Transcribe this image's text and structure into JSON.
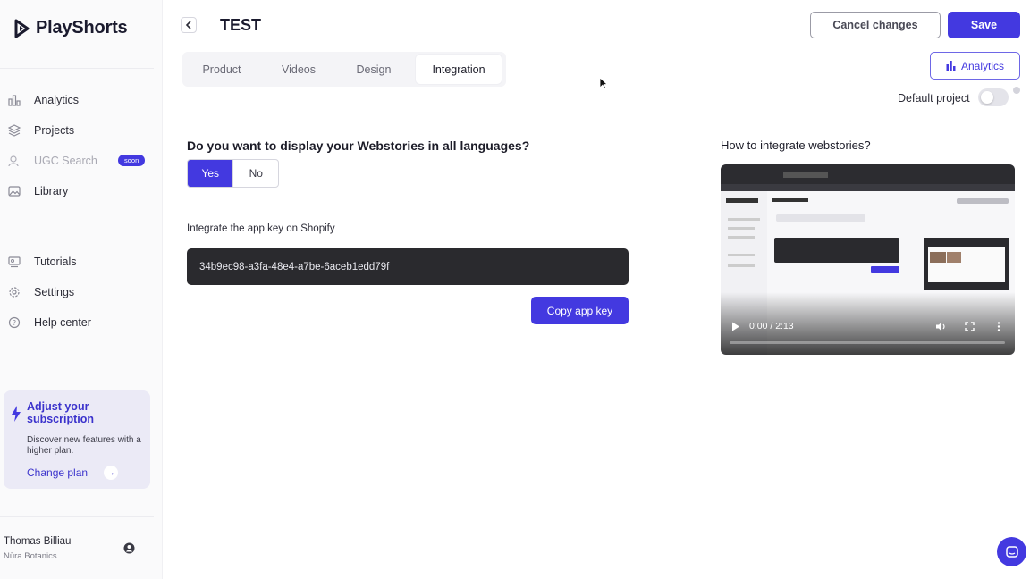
{
  "app": {
    "brand": "PlayShorts"
  },
  "sidebar": {
    "items": [
      {
        "label": "Analytics",
        "icon": "bar-chart-icon"
      },
      {
        "label": "Projects",
        "icon": "layers-icon"
      },
      {
        "label": "UGC Search",
        "icon": "users-search-icon",
        "badge": "soon",
        "disabled": true
      },
      {
        "label": "Library",
        "icon": "image-icon"
      },
      {
        "label": "Tutorials",
        "icon": "video-tutorial-icon"
      },
      {
        "label": "Settings",
        "icon": "gear-icon"
      },
      {
        "label": "Help center",
        "icon": "help-circle-icon"
      }
    ],
    "subscription": {
      "title": "Adjust your subscription",
      "description": "Discover new features with a higher plan.",
      "link": "Change plan"
    },
    "user": {
      "name": "Thomas Billiau",
      "org": "Nūra Botanics"
    }
  },
  "header": {
    "title": "TEST",
    "cancel_label": "Cancel changes",
    "save_label": "Save",
    "analytics_label": "Analytics",
    "default_project_label": "Default project",
    "default_project_on": false
  },
  "tabs": [
    {
      "label": "Product",
      "active": false
    },
    {
      "label": "Videos",
      "active": false
    },
    {
      "label": "Design",
      "active": false
    },
    {
      "label": "Integration",
      "active": true
    }
  ],
  "main": {
    "question": "Do you want to display your Webstories in all languages?",
    "yes_label": "Yes",
    "no_label": "No",
    "selected": "Yes",
    "integrate_label": "Integrate the app key on Shopify",
    "app_key": "34b9ec98-a3fa-48e4-a7be-6aceb1edd79f",
    "copy_label": "Copy app key"
  },
  "video": {
    "title": "How to integrate webstories?",
    "time": "0:00 / 2:13",
    "progress": 0
  },
  "colors": {
    "accent": "#4339e0",
    "dark_box": "#2a2a2e"
  }
}
